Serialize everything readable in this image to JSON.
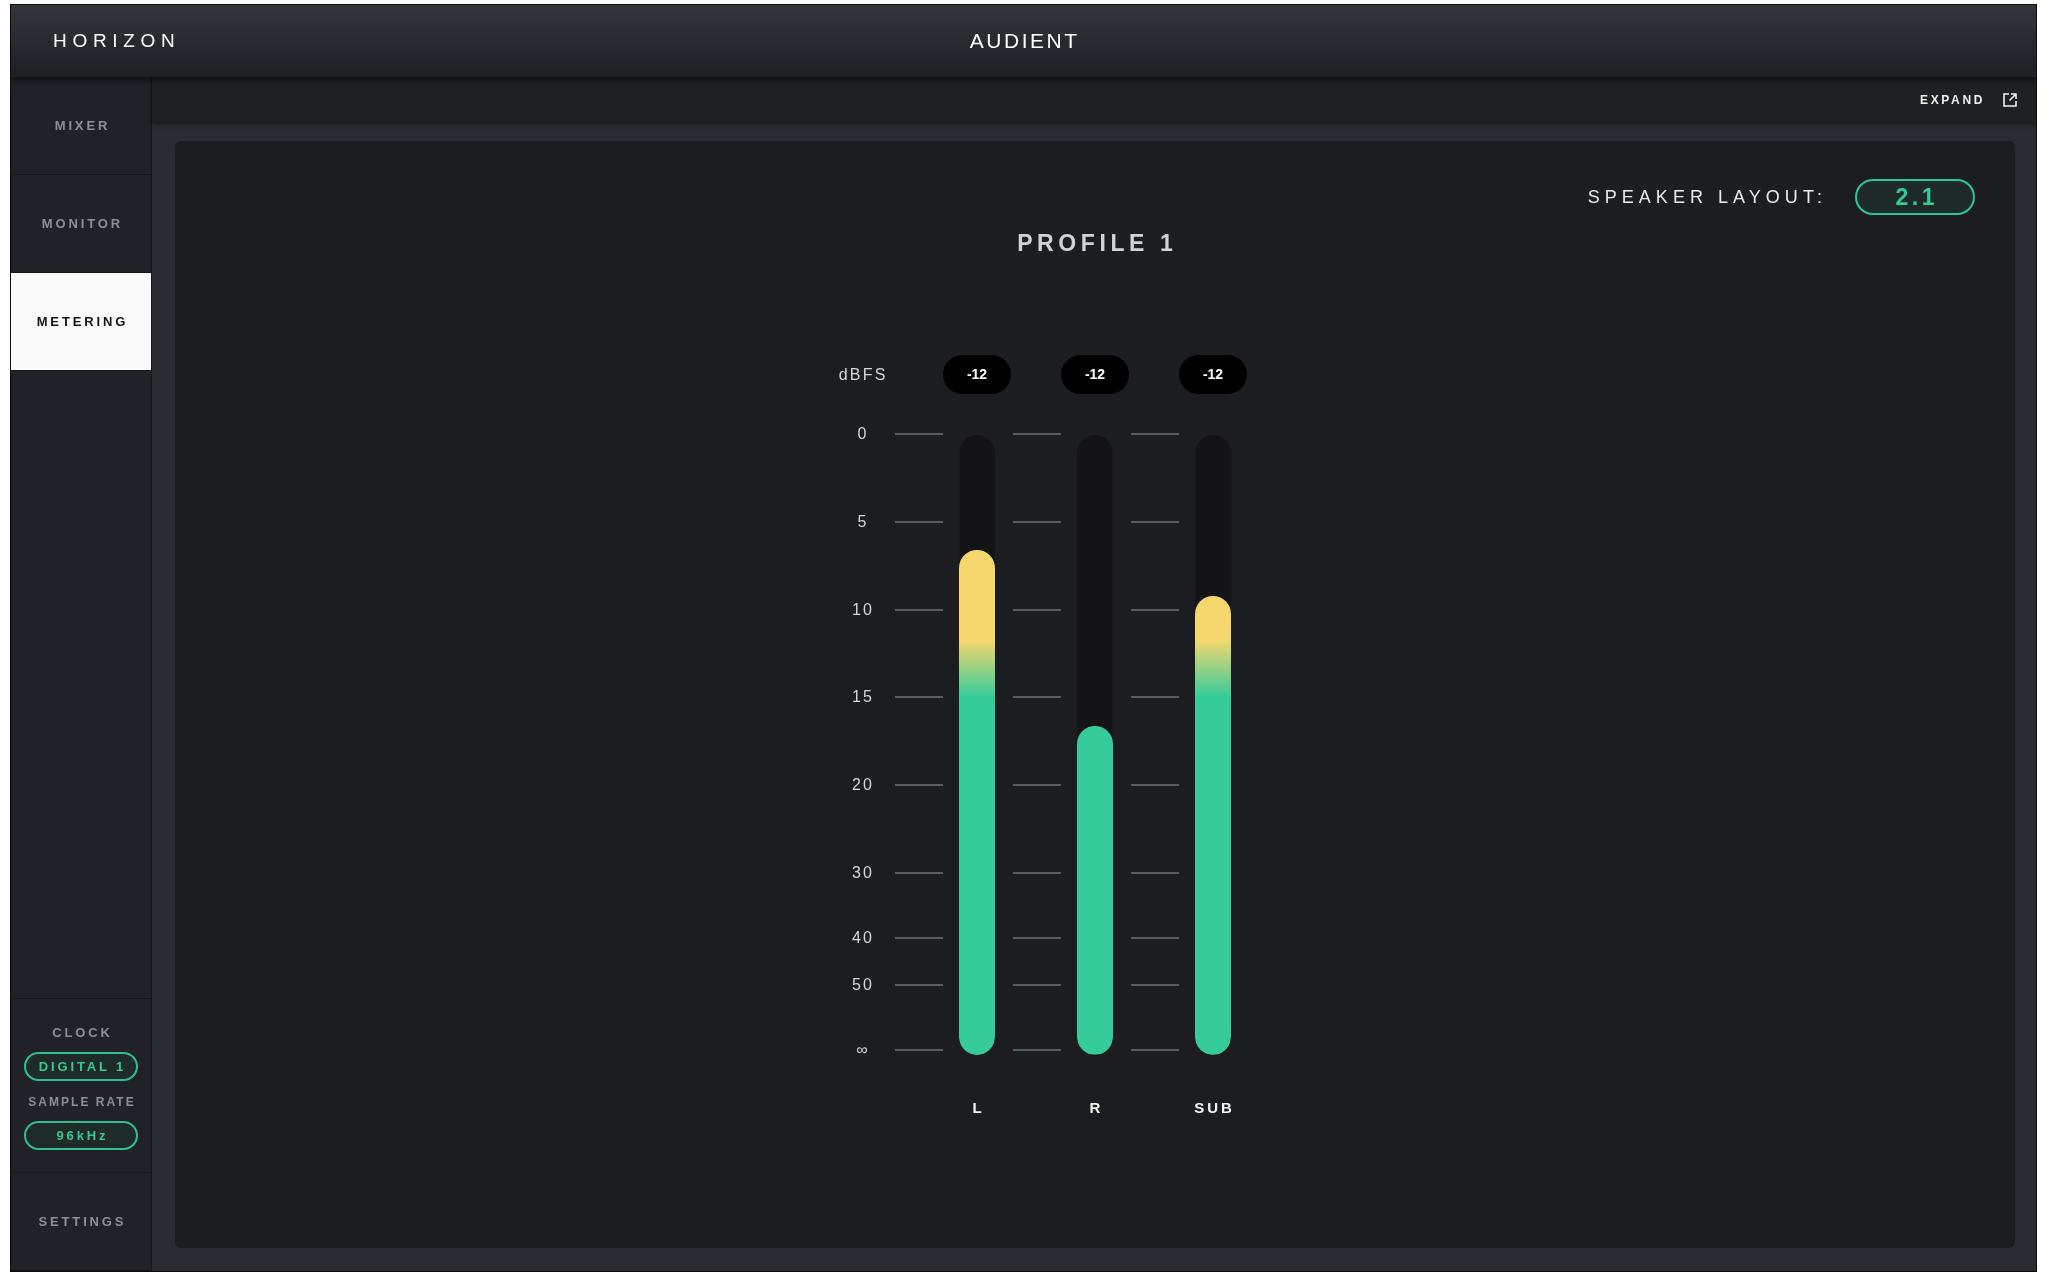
{
  "app": {
    "title": "HORIZON",
    "brand": "AUDIENT"
  },
  "sidebar": {
    "items": [
      {
        "label": "MIXER",
        "selected": false
      },
      {
        "label": "MONITOR",
        "selected": false
      },
      {
        "label": "METERING",
        "selected": true
      }
    ],
    "clock": {
      "label": "CLOCK",
      "value": "DIGITAL 1"
    },
    "sample_rate": {
      "label": "SAMPLE RATE",
      "value": "96kHz"
    },
    "settings": {
      "label": "SETTINGS",
      "selected": false
    }
  },
  "toolbar": {
    "expand": "EXPAND"
  },
  "panel": {
    "speaker_layout": {
      "label": "SPEAKER LAYOUT:",
      "value": "2.1"
    },
    "title": "PROFILE 1",
    "meter": {
      "unit": "dBFS",
      "scale": [
        "0",
        "5",
        "10",
        "15",
        "20",
        "30",
        "40",
        "50",
        "∞"
      ],
      "channels": [
        {
          "name": "L",
          "reading": "-12",
          "level": 0.815
        },
        {
          "name": "R",
          "reading": "-12",
          "level": 0.53
        },
        {
          "name": "SUB",
          "reading": "-12",
          "level": 0.74
        }
      ]
    }
  }
}
